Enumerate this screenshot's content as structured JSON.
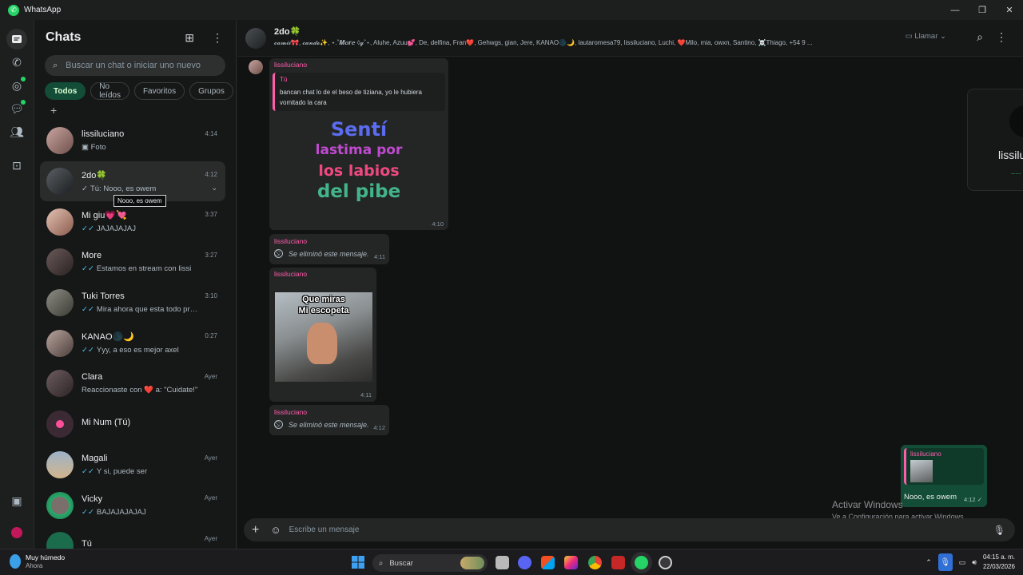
{
  "window": {
    "title": "WhatsApp"
  },
  "sidebar": {
    "title": "Chats",
    "search_placeholder": "Buscar un chat o iniciar uno nuevo",
    "filters": [
      "Todos",
      "No leídos",
      "Favoritos",
      "Grupos"
    ],
    "chats": [
      {
        "name": "lissiluciano",
        "time": "4:14",
        "preview": "Foto",
        "tick": "none"
      },
      {
        "name": "2do🍀",
        "time": "4:12",
        "preview": "Tú: Nooo, es owem",
        "tick": "grey"
      },
      {
        "name": "Mi giu💗💘",
        "time": "3:37",
        "preview": "JAJAJAJAJ",
        "tick": "blue"
      },
      {
        "name": "More",
        "time": "3:27",
        "preview": "Estamos en stream con lissi",
        "tick": "blue"
      },
      {
        "name": "Tuki Torres",
        "time": "3:10",
        "preview": "Mira ahora que esta todo preparado",
        "tick": "blue"
      },
      {
        "name": "KANAO🌑🌙",
        "time": "0:27",
        "preview": "Yyy, a eso es mejor axel",
        "tick": "blue"
      },
      {
        "name": "Clara",
        "time": "Ayer",
        "preview": "Reaccionaste con ❤️ a: \"Cuidate!\"",
        "tick": "none"
      },
      {
        "name": "Mi Num (Tú)",
        "time": "",
        "preview": "",
        "tick": "none"
      },
      {
        "name": "Magali",
        "time": "Ayer",
        "preview": "Y si, puede ser",
        "tick": "blue"
      },
      {
        "name": "Vicky",
        "time": "Ayer",
        "preview": "BAJAJAJAJAJ",
        "tick": "blue"
      },
      {
        "name": "Tú",
        "time": "Ayer",
        "preview": "",
        "tick": "none"
      }
    ],
    "tooltip": "Nooo, es owem"
  },
  "conversation": {
    "group_name": "2do🍀",
    "members": "𝓬𝓪𝓶𝓲𝓲🎀, 𝓬𝓪𝓷𝓭𝓮✨, ⋆.˚𝑴𝒐𝒓𝒆 ◊𝓰˚⋆, Aluhe, Azuu💕, De, delfina, Fran❤️, Gehwgs, gian, Jere, KANAO🌑🌙, lautaromesa79, lissiluciano, Luchi, ❤️Milo, mia, owxn, Santino, ☠️Thiago, +54 9 ...",
    "call_label": "Llamar",
    "messages": [
      {
        "sender": "lissiluciano",
        "quote_author": "Tú",
        "quote_text": "bancan chat lo de el beso de tiziana, yo le hubiera vomitado la cara",
        "sticker_lines": [
          "Sentí",
          "lastima por",
          "los labios",
          "del pibe"
        ],
        "time": "4:10"
      },
      {
        "sender": "lissiluciano",
        "deleted": "Se eliminó este mensaje.",
        "time": "4:11"
      },
      {
        "sender": "lissiluciano",
        "sticker_lines": [
          "Que miras",
          "Mi escopeta"
        ],
        "time": "4:11"
      },
      {
        "sender": "lissiluciano",
        "deleted": "Se eliminó este mensaje.",
        "time": "4:12"
      }
    ],
    "reply": {
      "quote_author": "lissiluciano",
      "text": "Nooo, es owem",
      "time": "4:12"
    },
    "side_card_text": "lissilu",
    "composer_placeholder": "Escribe un mensaje",
    "activation": {
      "line1": "Activar Windows",
      "line2": "Ve a Configuración para activar Windows."
    }
  },
  "taskbar": {
    "weather_line1": "Muy húmedo",
    "weather_line2": "Ahora",
    "search": "Buscar",
    "time": "04:15 a. m.",
    "date": "22/03/2026"
  }
}
